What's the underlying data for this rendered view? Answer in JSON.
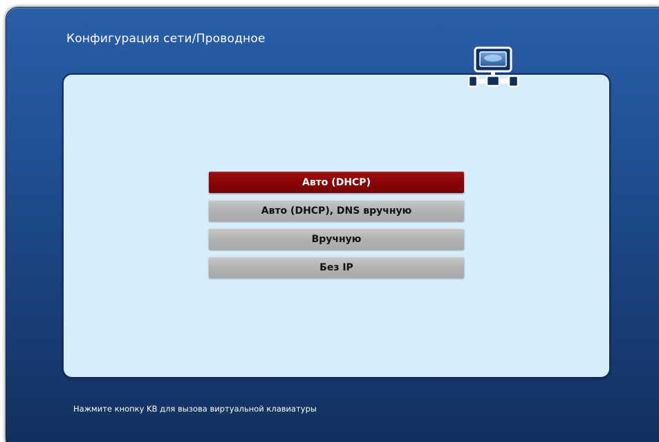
{
  "window": {
    "title": "Конфигурация сети/Проводное"
  },
  "header_icon": "network-computer-icon",
  "menu": {
    "selected_index": 0,
    "items": [
      {
        "label": "Авто (DHCP)"
      },
      {
        "label": "Авто (DHCP), DNS вручную"
      },
      {
        "label": "Вручную"
      },
      {
        "label": "Без IP"
      }
    ]
  },
  "footer": {
    "hint": "Нажмите кнопку KB для вызова виртуальной клавиатуры"
  },
  "colors": {
    "background_blue": "#23549a",
    "panel": "#d6eefc",
    "selected_item": "#8a0505",
    "item": "#b2b2b2"
  }
}
